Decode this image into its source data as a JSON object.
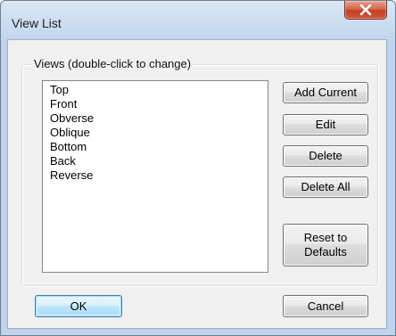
{
  "window": {
    "title": "View List",
    "close_icon": "close-icon"
  },
  "views_group": {
    "label": "Views (double-click to change)",
    "items": [
      "Top",
      "Front",
      "Obverse",
      "Oblique",
      "Bottom",
      "Back",
      "Reverse"
    ]
  },
  "buttons": {
    "add_current": "Add Current",
    "edit": "Edit",
    "delete": "Delete",
    "delete_all": "Delete All",
    "reset_line1": "Reset to",
    "reset_line2": "Defaults",
    "ok": "OK",
    "cancel": "Cancel"
  },
  "colors": {
    "close_button": "#c94a2e",
    "default_button_border": "#3c7fb1"
  }
}
